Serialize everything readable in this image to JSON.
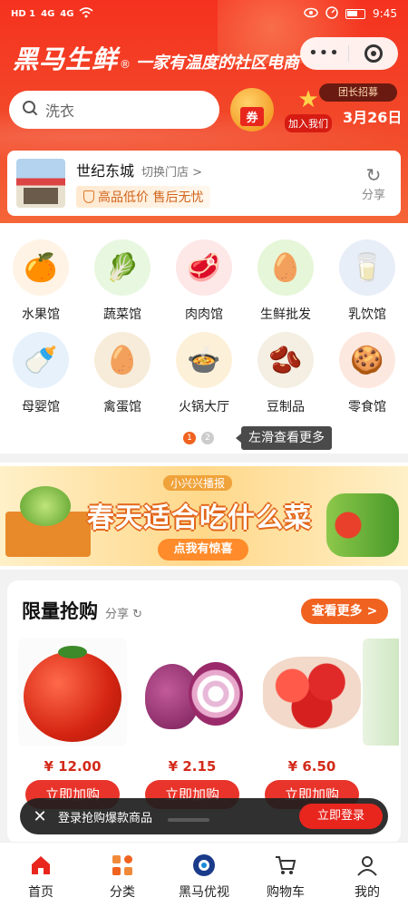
{
  "status_bar": {
    "network": "HD 1",
    "sig1": "4G",
    "sig2": "4G",
    "time": "9:45"
  },
  "brand": {
    "name": "黑马生鲜",
    "reg": "®",
    "slogan": "一家有温度的社区电商"
  },
  "capsule": {
    "more": "•••"
  },
  "search": {
    "placeholder": "洗衣"
  },
  "promo": {
    "coupon_label": "券",
    "join_label": "加入我们",
    "leader_label": "团长招募",
    "date": "3月26日"
  },
  "store": {
    "name": "世纪东城",
    "switch_label": "切换门店 >",
    "tagline": "高品低价 售后无忧",
    "share_label": "分享"
  },
  "categories": [
    {
      "label": "水果馆",
      "icon": "fruit-icon",
      "glyph": "🍊",
      "bg": "#fff3e6"
    },
    {
      "label": "蔬菜馆",
      "icon": "vegetable-icon",
      "glyph": "🥬",
      "bg": "#e8f7e0"
    },
    {
      "label": "肉肉馆",
      "icon": "meat-icon",
      "glyph": "🥩",
      "bg": "#fde7e7"
    },
    {
      "label": "生鲜批发",
      "icon": "eggs-wholesale-icon",
      "glyph": "🥚",
      "bg": "#e6f6d8"
    },
    {
      "label": "乳饮馆",
      "icon": "milk-icon",
      "glyph": "🥛",
      "bg": "#e8eef8"
    },
    {
      "label": "母婴馆",
      "icon": "baby-icon",
      "glyph": "🍼",
      "bg": "#e6f1fb"
    },
    {
      "label": "禽蛋馆",
      "icon": "egg-icon",
      "glyph": "🥚",
      "bg": "#f7ecd9"
    },
    {
      "label": "火锅大厅",
      "icon": "hotpot-icon",
      "glyph": "🍲",
      "bg": "#fdf0d8"
    },
    {
      "label": "豆制品",
      "icon": "tofu-icon",
      "glyph": "🫘",
      "bg": "#f4efe2"
    },
    {
      "label": "零食馆",
      "icon": "snack-icon",
      "glyph": "🍪",
      "bg": "#fde8e0"
    }
  ],
  "pager": {
    "dot1": "1",
    "dot2": "2",
    "tip": "左滑查看更多"
  },
  "banner": {
    "small": "小兴兴播报",
    "title": "春天适合吃什么菜",
    "cta": "点我有惊喜"
  },
  "flash_sale": {
    "title": "限量抢购",
    "share_label": "分享",
    "more_label": "查看更多 >",
    "products": [
      {
        "price": "¥ 12.00",
        "buy_label": "立即加购",
        "image": "tomato"
      },
      {
        "price": "¥ 2.15",
        "buy_label": "立即加购",
        "image": "onion"
      },
      {
        "price": "¥ 6.50",
        "buy_label": "立即加购",
        "image": "straw"
      }
    ]
  },
  "toast": {
    "close": "✕",
    "message": "登录抢购爆款商品",
    "login_label": "立即登录"
  },
  "tabbar": [
    {
      "label": "首页",
      "icon": "home-icon",
      "active": true
    },
    {
      "label": "分类",
      "icon": "category-icon"
    },
    {
      "label": "黑马优视",
      "icon": "video-icon"
    },
    {
      "label": "购物车",
      "icon": "cart-icon"
    },
    {
      "label": "我的",
      "icon": "profile-icon"
    }
  ],
  "colors": {
    "brand_red": "#f5321f",
    "accent_orange": "#f0621f",
    "price_red": "#d32a1a"
  }
}
